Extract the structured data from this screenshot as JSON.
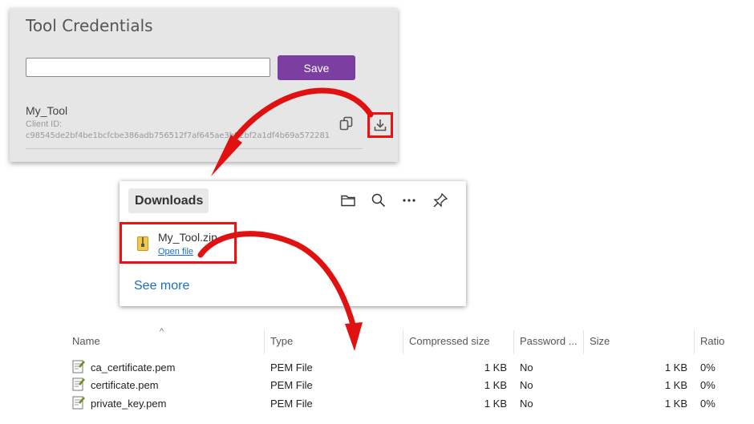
{
  "credentials": {
    "title": "Tool Credentials",
    "input_value": "",
    "save_label": "Save",
    "tool_name": "My_Tool",
    "client_id_label": "Client ID:",
    "client_id": "c98545de2bf4be1bcfcbe386adb756512f7af645ae3b52bf2a1df4b69a572281",
    "icons": {
      "copy": "copy-icon",
      "download": "download-icon"
    }
  },
  "downloads": {
    "title": "Downloads",
    "header_icons": [
      "folder-icon",
      "search-icon",
      "more-icon",
      "pin-icon"
    ],
    "file_name": "My_Tool.zip",
    "open_file_label": "Open file",
    "see_more_label": "See more"
  },
  "explorer": {
    "columns": [
      "Name",
      "Type",
      "Compressed size",
      "Password ...",
      "Size",
      "Ratio"
    ],
    "rows": [
      {
        "name": "ca_certificate.pem",
        "type": "PEM File",
        "compressed_size": "1 KB",
        "password": "No",
        "size": "1 KB",
        "ratio": "0%"
      },
      {
        "name": "certificate.pem",
        "type": "PEM File",
        "compressed_size": "1 KB",
        "password": "No",
        "size": "1 KB",
        "ratio": "0%"
      },
      {
        "name": "private_key.pem",
        "type": "PEM File",
        "compressed_size": "1 KB",
        "password": "No",
        "size": "1 KB",
        "ratio": "0%"
      }
    ]
  },
  "colors": {
    "accent_purple": "#7a3fa1",
    "highlight_red": "#e11111",
    "link_blue": "#1a6fc4"
  }
}
